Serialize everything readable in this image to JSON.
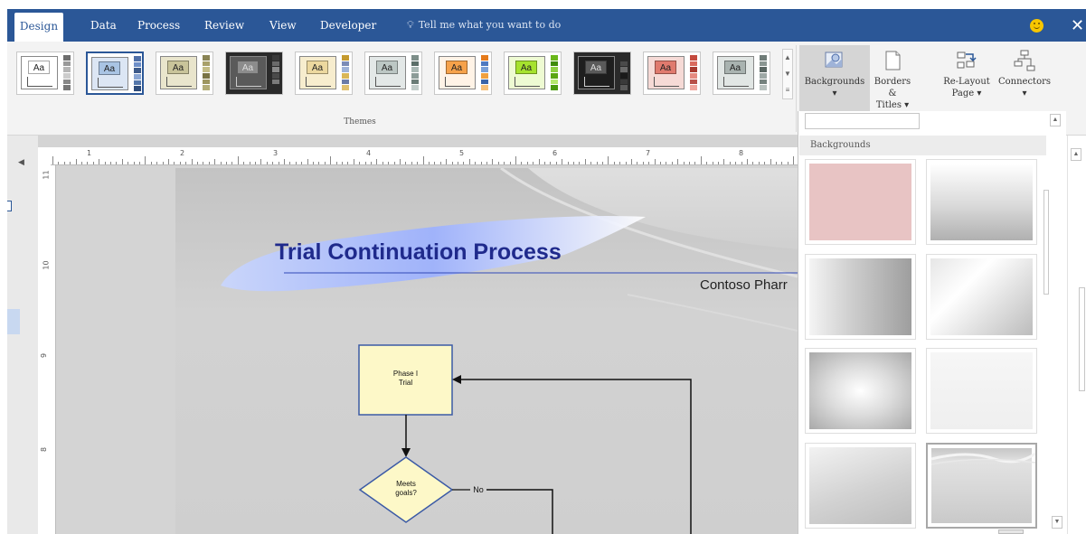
{
  "tabs": [
    {
      "label": "Design",
      "active": true
    },
    {
      "label": "Data"
    },
    {
      "label": "Process"
    },
    {
      "label": "Review"
    },
    {
      "label": "View"
    },
    {
      "label": "Developer"
    }
  ],
  "tell_me": {
    "icon": "lightbulb-icon",
    "text": "Tell me what you want to do"
  },
  "window": {
    "close_glyph": "✕"
  },
  "ribbon": {
    "theme_sample_text": "Aa",
    "themes_group_label": "Themes",
    "scroll_up": "▲",
    "scroll_down": "▼",
    "scroll_more": "≡",
    "buttons": {
      "backgrounds": {
        "label": "Backgrounds",
        "arrow": "▾",
        "icon": "backgrounds-icon"
      },
      "borders": {
        "label": "Borders &",
        "label2": "Titles ▾",
        "icon": "borders-titles-icon"
      },
      "relayout": {
        "label": "Re-Layout",
        "label2": "Page ▾",
        "icon": "relayout-page-icon"
      },
      "connectors": {
        "label": "Connectors",
        "arrow": "▾",
        "icon": "connectors-icon"
      }
    }
  },
  "themes": [
    {
      "aa_bg": "#ffffff",
      "frame": "#ffffff",
      "strip": [
        "#6d6d6d",
        "#999999",
        "#b5b5b5",
        "#cccccc",
        "#888888",
        "#777777"
      ]
    },
    {
      "aa_bg": "#a9c4e4",
      "frame": "#dce6f4",
      "strip": [
        "#4f6fa8",
        "#6e8fc8",
        "#3d5a8a",
        "#8aa6d4",
        "#5577aa",
        "#2f4c7a"
      ],
      "selected": true
    },
    {
      "aa_bg": "#c9c49a",
      "frame": "#e9e5cc",
      "strip": [
        "#8a8455",
        "#a8a06a",
        "#c4bd86",
        "#7a7444",
        "#9d9660",
        "#b3ad78"
      ]
    },
    {
      "aa_bg": "#8c8c8c",
      "frame": "#5a5a5a",
      "strip": [
        "#3a3a3a",
        "#6a6a6a",
        "#8a8a8a",
        "#4a4a4a",
        "#7a7a7a",
        "#2a2a2a"
      ],
      "dark": true
    },
    {
      "aa_bg": "#ecd89f",
      "frame": "#f7edce",
      "strip": [
        "#c59a2e",
        "#7b8bb6",
        "#9fb3d8",
        "#d9b658",
        "#6b7ba8",
        "#e0c070"
      ]
    },
    {
      "aa_bg": "#bcc7c4",
      "frame": "#e3e8e7",
      "strip": [
        "#7d8e89",
        "#5b6e68",
        "#a9b8b4",
        "#8c9c98",
        "#6b7d77",
        "#c2cdca"
      ]
    },
    {
      "aa_bg": "#f6a24a",
      "frame": "#fff3e6",
      "strip": [
        "#e57a1a",
        "#4f79c0",
        "#7aa0d8",
        "#f0a040",
        "#3a64a8",
        "#f7c07a"
      ]
    },
    {
      "aa_bg": "#a6e22e",
      "frame": "#eefbd2",
      "strip": [
        "#6ab71a",
        "#3f8c0a",
        "#8fd142",
        "#5aa612",
        "#b5e86e",
        "#4a9a0e"
      ]
    },
    {
      "aa_bg": "#5a5a5a",
      "frame": "#1e1e1e",
      "strip": [
        "#2a2a2a",
        "#4a4a4a",
        "#6a6a6a",
        "#1a1a1a",
        "#3a3a3a",
        "#5a5a5a"
      ],
      "dark": true
    },
    {
      "aa_bg": "#e07a6e",
      "frame": "#f6dad6",
      "strip": [
        "#c44a3e",
        "#d96a5e",
        "#a83a30",
        "#e58a80",
        "#b85048",
        "#f0a59c"
      ]
    },
    {
      "aa_bg": "#a9b3b0",
      "frame": "#e1e6e4",
      "strip": [
        "#6f7c78",
        "#8a9692",
        "#5a6763",
        "#9ea9a6",
        "#76837f",
        "#b9c2bf"
      ]
    }
  ],
  "ruler": {
    "h_marks": [
      "1",
      "2",
      "3",
      "4",
      "5",
      "6",
      "7",
      "8"
    ],
    "v_marks": [
      "11",
      "10",
      "9",
      "8"
    ]
  },
  "diagram": {
    "title": "Trial Continuation Process",
    "subtitle": "Contoso Pharr",
    "shapes": {
      "phase_box": "Phase I\nTrial",
      "decision": "Meets\ngoals?",
      "no_label": "No"
    }
  },
  "backgrounds_panel": {
    "header": "Backgrounds",
    "scroll_up": "▲",
    "scroll_down": "▼",
    "thumbs": [
      {
        "style": "pink-solid"
      },
      {
        "style": "gradient-top-white"
      },
      {
        "style": "gradient-left-white"
      },
      {
        "style": "gradient-diagonal"
      },
      {
        "style": "radial-center"
      },
      {
        "style": "light-flat"
      },
      {
        "style": "gradient-corner"
      },
      {
        "style": "wave-top",
        "selected": true
      }
    ]
  },
  "colors": {
    "accent": "#2b5797",
    "title": "#1f2a8c",
    "flow_box": "#fdf8c8",
    "flow_border": "#3b5aa6"
  }
}
